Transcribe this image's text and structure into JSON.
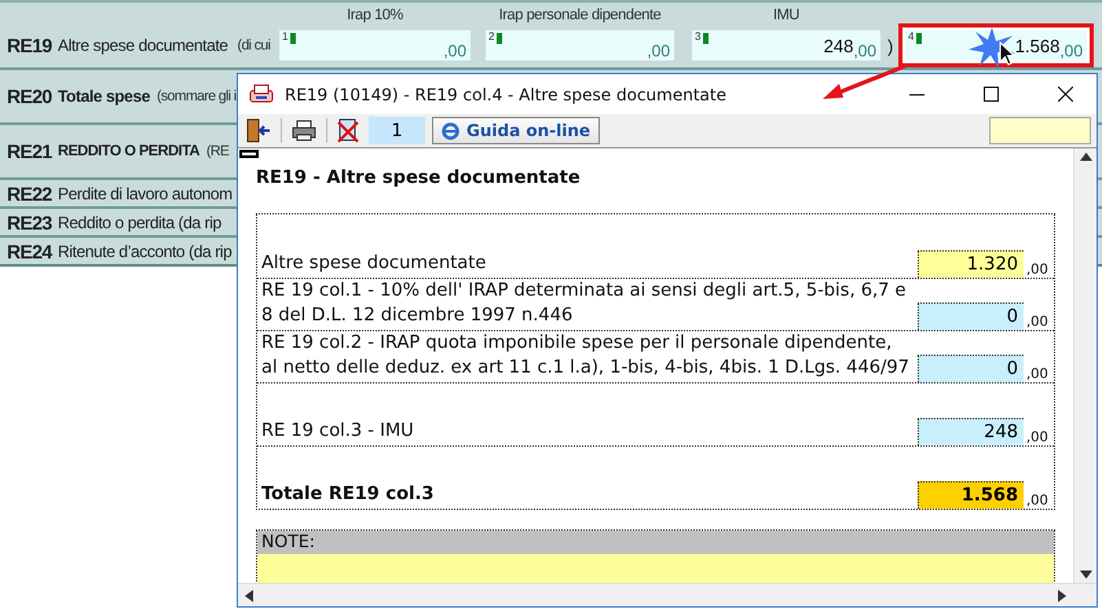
{
  "form": {
    "column_headers": [
      "Irap 10%",
      "Irap personale dipendente",
      "IMU"
    ],
    "rows": [
      {
        "code": "RE19",
        "label": "Altre spese documentate",
        "note": "(di cui",
        "kind": "fields"
      },
      {
        "code": "RE20",
        "label": "Totale spese",
        "note": "(sommare gli i",
        "kind": "bold"
      },
      {
        "code": "RE21",
        "label": "REDDITO O PERDITA",
        "note": "(RE",
        "kind": "caps"
      },
      {
        "code": "RE22",
        "label": "Perdite di lavoro autonom",
        "kind": "plain"
      },
      {
        "code": "RE23",
        "label": "Reddito o perdita (da rip",
        "kind": "plain"
      },
      {
        "code": "RE24",
        "label": "Ritenute d’acconto (da rip",
        "kind": "plain"
      }
    ],
    "fields": [
      {
        "number": "1",
        "decimals": ",00",
        "highlighted": false
      },
      {
        "number": "2",
        "decimals": ",00",
        "highlighted": false
      },
      {
        "number": "3",
        "value": "248",
        "decimals": ",00",
        "highlighted": false
      },
      {
        "number": "4",
        "value": "1.568",
        "decimals": ",00",
        "highlighted": true
      }
    ],
    "closing_paren": ")"
  },
  "popup": {
    "title": "RE19 (10149) - RE19 col.4 - Altre spese documentate",
    "toolbar": {
      "page": "1",
      "help_button": "Guida on-line"
    },
    "heading": "RE19 - Altre spese documentate",
    "rows": [
      {
        "label": "Altre spese documentate",
        "value": "1.320",
        "decimals": ",00",
        "kind": "input"
      },
      {
        "label": "RE 19 col.1 - 10% dell' IRAP determinata ai sensi degli art.5, 5-bis, 6,7 e 8 del D.L. 12 dicembre 1997 n.446",
        "value": "0",
        "decimals": ",00",
        "kind": "computed"
      },
      {
        "label": "RE 19 col.2 - IRAP quota imponibile spese per il personale dipendente, al netto delle deduz. ex art 11 c.1 l.a), 1-bis, 4-bis, 4bis. 1 D.Lgs. 446/97",
        "value": "0",
        "decimals": ",00",
        "kind": "computed"
      },
      {
        "label": "RE 19 col.3 - IMU",
        "value": "248",
        "decimals": ",00",
        "kind": "computed"
      },
      {
        "label": "Totale RE19 col.3",
        "value": "1.568",
        "decimals": ",00",
        "kind": "total"
      }
    ],
    "notes_label": "NOTE:"
  }
}
